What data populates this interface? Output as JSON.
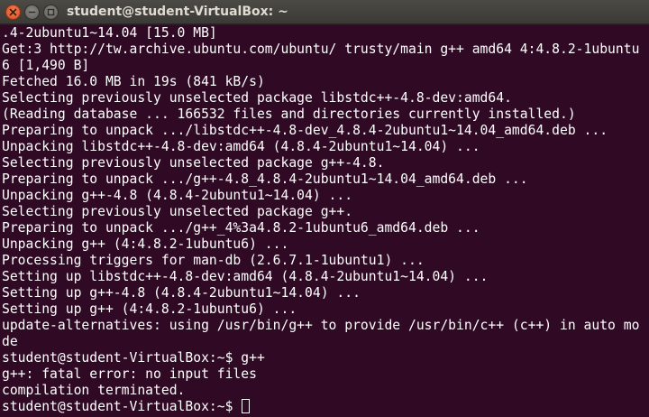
{
  "window": {
    "title": "student@student-VirtualBox: ~"
  },
  "terminal": {
    "lines": [
      ".4-2ubuntu1~14.04 [15.0 MB]",
      "Get:3 http://tw.archive.ubuntu.com/ubuntu/ trusty/main g++ amd64 4:4.8.2-1ubuntu",
      "6 [1,490 B]",
      "Fetched 16.0 MB in 19s (841 kB/s)",
      "Selecting previously unselected package libstdc++-4.8-dev:amd64.",
      "(Reading database ... 166532 files and directories currently installed.)",
      "Preparing to unpack .../libstdc++-4.8-dev_4.8.4-2ubuntu1~14.04_amd64.deb ...",
      "Unpacking libstdc++-4.8-dev:amd64 (4.8.4-2ubuntu1~14.04) ...",
      "Selecting previously unselected package g++-4.8.",
      "Preparing to unpack .../g++-4.8_4.8.4-2ubuntu1~14.04_amd64.deb ...",
      "Unpacking g++-4.8 (4.8.4-2ubuntu1~14.04) ...",
      "Selecting previously unselected package g++.",
      "Preparing to unpack .../g++_4%3a4.8.2-1ubuntu6_amd64.deb ...",
      "Unpacking g++ (4:4.8.2-1ubuntu6) ...",
      "Processing triggers for man-db (2.6.7.1-1ubuntu1) ...",
      "Setting up libstdc++-4.8-dev:amd64 (4.8.4-2ubuntu1~14.04) ...",
      "Setting up g++-4.8 (4.8.4-2ubuntu1~14.04) ...",
      "Setting up g++ (4:4.8.2-1ubuntu6) ...",
      "update-alternatives: using /usr/bin/g++ to provide /usr/bin/c++ (c++) in auto mo",
      "de",
      "student@student-VirtualBox:~$ g++",
      "g++: fatal error: no input files",
      "compilation terminated."
    ],
    "prompt": "student@student-VirtualBox:~$ "
  },
  "colors": {
    "terminal_background": "#300a24",
    "terminal_text": "#ffffff",
    "close_button": "#e95420",
    "titlebar": "#43423e"
  },
  "icons": {
    "close": "close-icon",
    "minimize": "minimize-icon",
    "maximize": "maximize-icon"
  }
}
